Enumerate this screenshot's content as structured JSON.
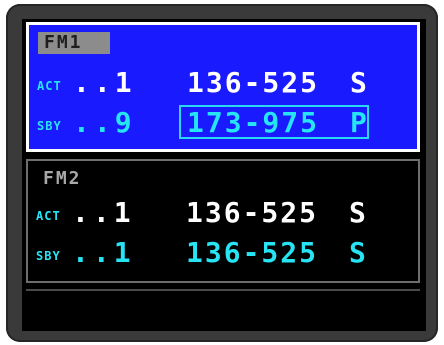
{
  "fm1": {
    "title": "FM1",
    "active": {
      "label": "ACT",
      "channel": "..1",
      "frequency": "136-525",
      "mode": "S"
    },
    "standby": {
      "label": "SBY",
      "channel": "..9",
      "frequency": "173-975",
      "mode": "P"
    }
  },
  "fm2": {
    "title": "FM2",
    "active": {
      "label": "ACT",
      "channel": "..1",
      "frequency": "136-525",
      "mode": "S"
    },
    "standby": {
      "label": "SBY",
      "channel": "..1",
      "frequency": "136-525",
      "mode": "S"
    }
  },
  "colors": {
    "fm1_background": "#1a1aff",
    "active_text": "#ffffff",
    "standby_text": "#27e4f5",
    "selection_box": "#27d8f0",
    "screen_background": "#000000",
    "bezel": "#3a3a3a"
  }
}
